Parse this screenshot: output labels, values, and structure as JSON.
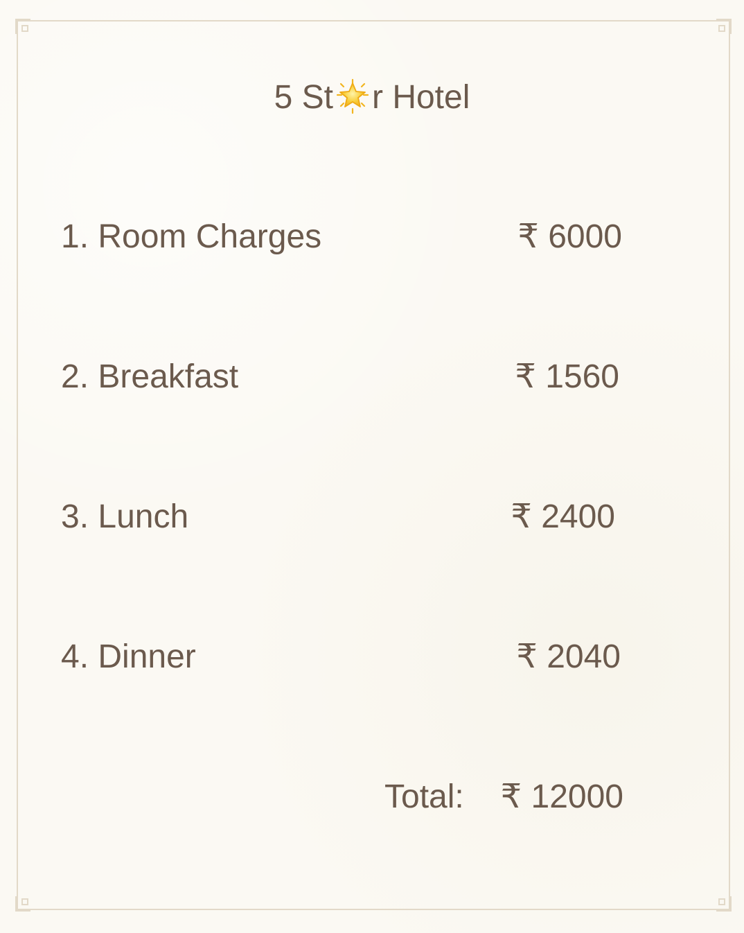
{
  "title": {
    "before_star": "5 St",
    "star_icon": "star-icon",
    "after_star": "r Hotel"
  },
  "items": [
    {
      "label": "1. Room Charges",
      "amount": "₹ 6000"
    },
    {
      "label": "2. Breakfast",
      "amount": "₹ 1560"
    },
    {
      "label": "3. Lunch",
      "amount": "₹ 2400"
    },
    {
      "label": "4. Dinner",
      "amount": "₹ 2040"
    }
  ],
  "total": {
    "label": "Total:",
    "amount": "₹ 12000"
  },
  "colors": {
    "background": "#fbf9f3",
    "text": "#6b5a4d",
    "border": "#e2d9c8",
    "star": "#f4c12b"
  }
}
